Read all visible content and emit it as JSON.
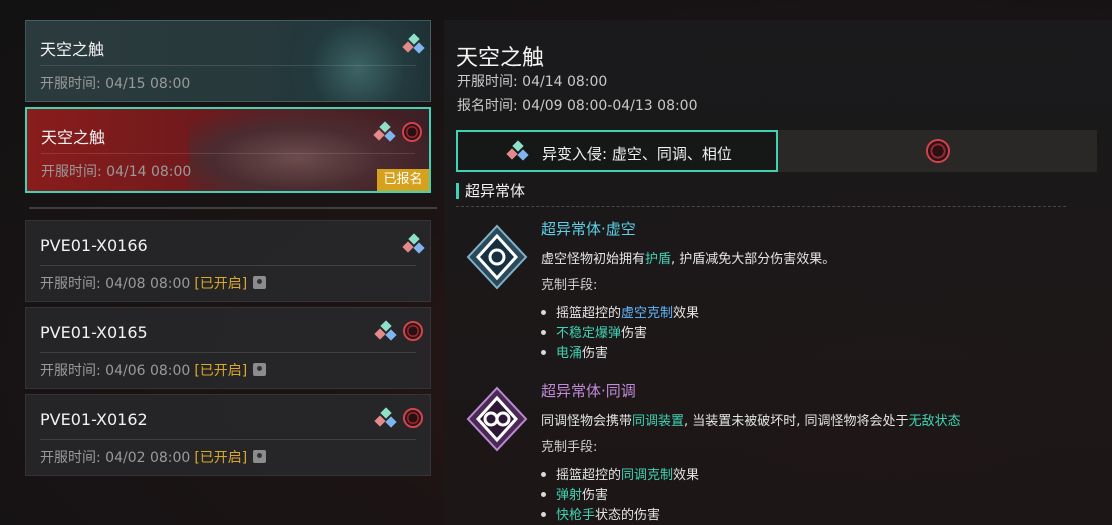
{
  "events": [
    {
      "title": "天空之触",
      "time": "开服时间: 04/15 08:00"
    },
    {
      "title": "天空之触",
      "time": "开服时间: 04/14 08:00",
      "badge": "已报名"
    },
    {
      "title": "PVE01-X0166",
      "time": "开服时间: 04/08 08:00",
      "status": "[已开启]"
    },
    {
      "title": "PVE01-X0165",
      "time": "开服时间: 04/06 08:00",
      "status": "[已开启]"
    },
    {
      "title": "PVE01-X0162",
      "time": "开服时间: 04/02 08:00",
      "status": "[已开启]"
    }
  ],
  "detail": {
    "title": "天空之触",
    "open_time": "开服时间: 04/14 08:00",
    "signup_time": "报名时间: 04/09 08:00-04/13 08:00",
    "tab1_label": "异变入侵: 虚空、同调、相位",
    "section_title": "超异常体",
    "entries": [
      {
        "title": "超异常体·虚空",
        "desc_pre": "虚空怪物初始拥有",
        "desc_hl": "护盾",
        "desc_post": ", 护盾减免大部分伤害效果。",
        "counter_label": "克制手段:",
        "b1_pre": "摇篮超控的",
        "b1_hl": "虚空克制",
        "b1_post": "效果",
        "b2_hl": "不稳定爆弹",
        "b2_post": "伤害",
        "b3_hl": "电涌",
        "b3_post": "伤害"
      },
      {
        "title": "超异常体·同调",
        "desc_pre": "同调怪物会携带",
        "desc_hl": "同调装置",
        "desc_mid": ", 当装置未被破坏时, 同调怪物将会处于",
        "desc_hl2": "无敌状态",
        "counter_label": "克制手段:",
        "b1_pre": "摇篮超控的",
        "b1_hl": "同调克制",
        "b1_post": "效果",
        "b2_hl": "弹射",
        "b2_post": "伤害",
        "b3_hl": "快枪手",
        "b3_post": "状态的伤害"
      }
    ]
  },
  "colors": {
    "accent": "#3fd3b4",
    "badge": "#d6a21e",
    "selected_bg": "#8a1c1c"
  },
  "icons": [
    "anomaly-shards-icon",
    "crimson-ring-icon",
    "void-hex-icon",
    "sync-hex-icon",
    "lock-icon"
  ]
}
